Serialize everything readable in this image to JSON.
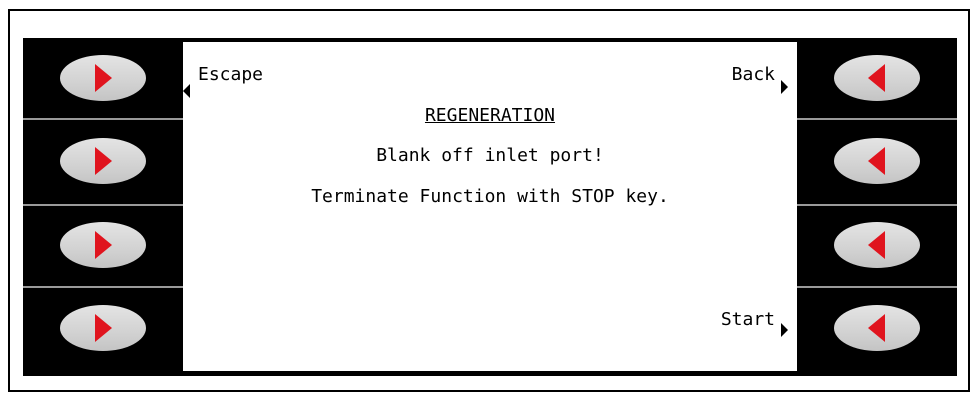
{
  "colors": {
    "arrow_red": "#e0141e",
    "key_grey": "#d8d8d8",
    "panel_black": "#000000"
  },
  "left_keys": [
    {
      "icon": "right-arrow-icon"
    },
    {
      "icon": "right-arrow-icon"
    },
    {
      "icon": "right-arrow-icon"
    },
    {
      "icon": "right-arrow-icon"
    }
  ],
  "right_keys": [
    {
      "icon": "left-arrow-icon"
    },
    {
      "icon": "left-arrow-icon"
    },
    {
      "icon": "left-arrow-icon"
    },
    {
      "icon": "left-arrow-icon"
    }
  ],
  "screen": {
    "softkeys": {
      "escape": "Escape",
      "back": "Back",
      "start": "Start"
    },
    "title": "REGENERATION",
    "line1": "Blank off inlet port!",
    "line2": "Terminate Function with STOP key."
  }
}
